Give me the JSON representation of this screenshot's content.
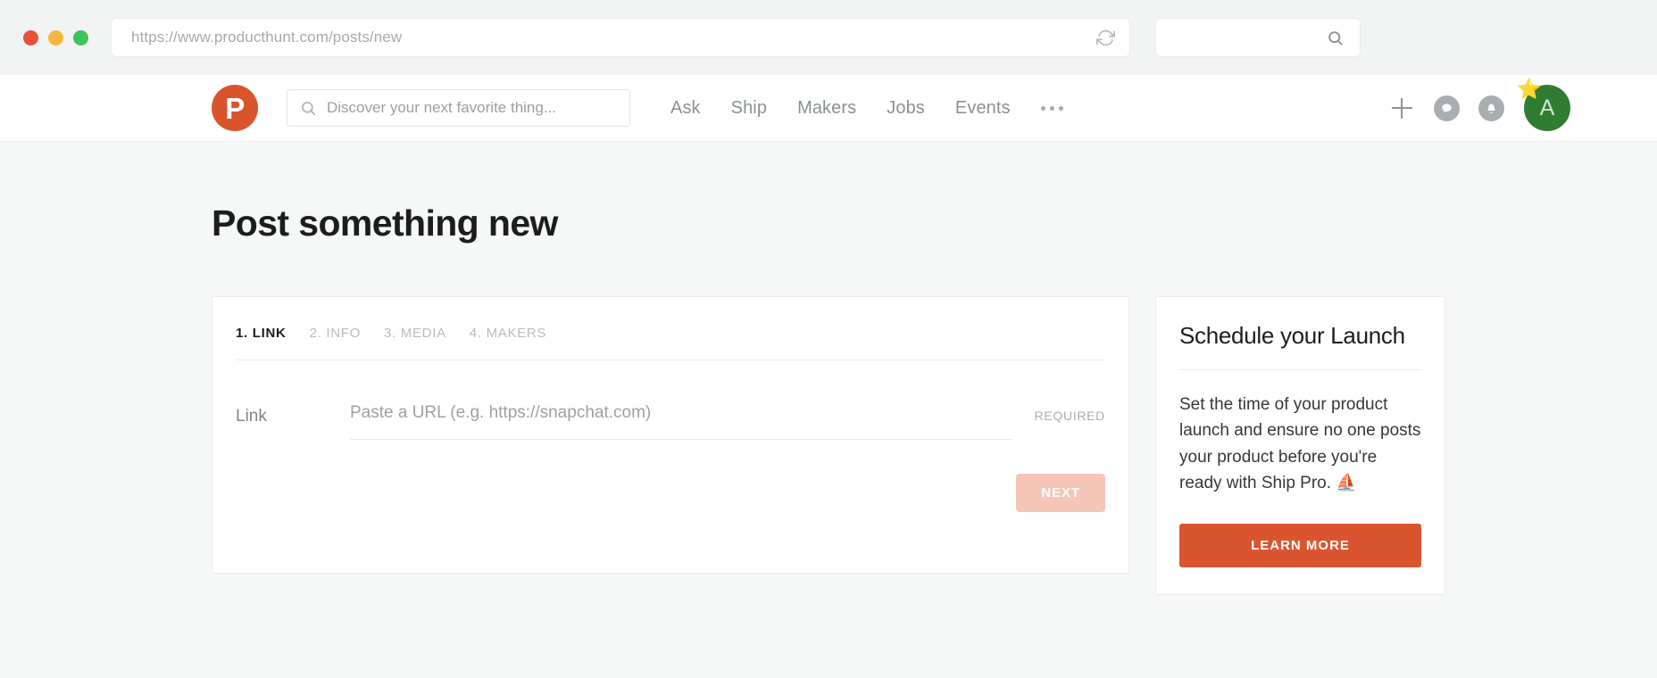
{
  "browser": {
    "url": "https://www.producthunt.com/posts/new",
    "reload_icon": "reload-icon",
    "search_placeholder": "",
    "search_icon": "search-icon",
    "traffic_lights": [
      {
        "name": "close",
        "color": "#e8503a"
      },
      {
        "name": "minimize",
        "color": "#f5b73d"
      },
      {
        "name": "maximize",
        "color": "#3ec35f"
      }
    ]
  },
  "nav": {
    "logo_letter": "P",
    "logo_color": "#d9542b",
    "search_placeholder": "Discover your next favorite thing...",
    "links": [
      {
        "label": "Ask"
      },
      {
        "label": "Ship"
      },
      {
        "label": "Makers"
      },
      {
        "label": "Jobs"
      },
      {
        "label": "Events"
      }
    ],
    "more_label": "•••",
    "icons": [
      {
        "name": "plus-icon"
      },
      {
        "name": "chat-bubble-icon"
      },
      {
        "name": "bell-icon"
      }
    ],
    "avatar": {
      "initial": "A",
      "color": "#2f7d32",
      "badge": "⭐"
    }
  },
  "main": {
    "title": "Post something new",
    "tabs": [
      {
        "label": "1. LINK",
        "active": true
      },
      {
        "label": "2. INFO",
        "active": false
      },
      {
        "label": "3. MEDIA",
        "active": false
      },
      {
        "label": "4. MAKERS",
        "active": false
      }
    ],
    "form": {
      "link_label": "Link",
      "link_value": "",
      "link_placeholder": "Paste a URL (e.g. https://snapchat.com)",
      "required_label": "REQUIRED"
    },
    "next_label": "NEXT",
    "next_color": "#f5c6b8"
  },
  "sidebar": {
    "title": "Schedule your Launch",
    "body": "Set the time of your product launch and ensure no one posts your product before you're ready with Ship Pro. ⛵",
    "cta_label": "LEARN MORE",
    "cta_color": "#da552f"
  }
}
